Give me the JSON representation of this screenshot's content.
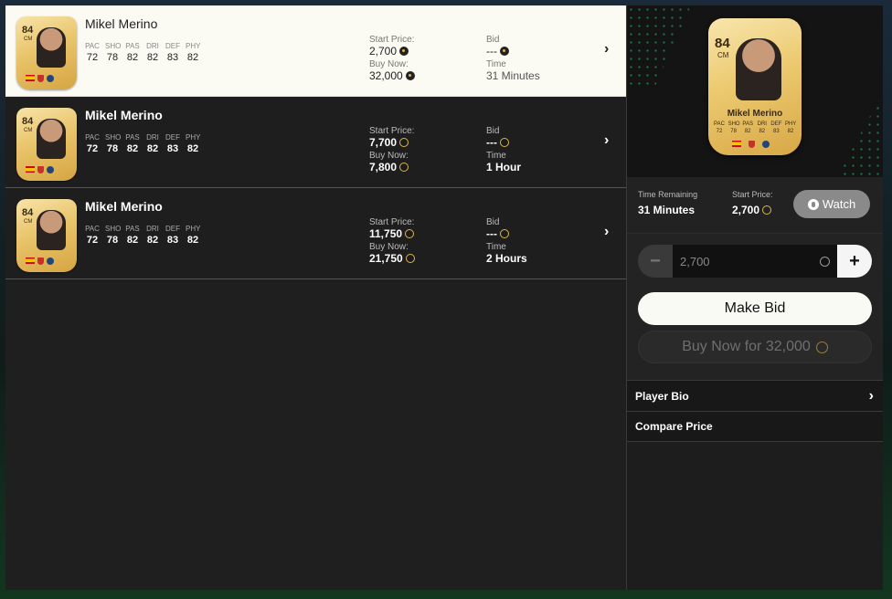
{
  "listings": [
    {
      "name": "Mikel Merino",
      "rating": "84",
      "position": "CM",
      "stats": [
        {
          "label": "PAC",
          "value": "72"
        },
        {
          "label": "SHO",
          "value": "78"
        },
        {
          "label": "PAS",
          "value": "82"
        },
        {
          "label": "DRI",
          "value": "82"
        },
        {
          "label": "DEF",
          "value": "83"
        },
        {
          "label": "PHY",
          "value": "82"
        }
      ],
      "start_price_label": "Start Price:",
      "start_price": "2,700",
      "buy_now_label": "Buy Now:",
      "buy_now": "32,000",
      "bid_label": "Bid",
      "bid": "---",
      "time_label": "Time",
      "time": "31 Minutes",
      "selected": true
    },
    {
      "name": "Mikel Merino",
      "rating": "84",
      "position": "CM",
      "stats": [
        {
          "label": "PAC",
          "value": "72"
        },
        {
          "label": "SHO",
          "value": "78"
        },
        {
          "label": "PAS",
          "value": "82"
        },
        {
          "label": "DRI",
          "value": "82"
        },
        {
          "label": "DEF",
          "value": "83"
        },
        {
          "label": "PHY",
          "value": "82"
        }
      ],
      "start_price_label": "Start Price:",
      "start_price": "7,700",
      "buy_now_label": "Buy Now:",
      "buy_now": "7,800",
      "bid_label": "Bid",
      "bid": "---",
      "time_label": "Time",
      "time": "1 Hour",
      "selected": false
    },
    {
      "name": "Mikel Merino",
      "rating": "84",
      "position": "CM",
      "stats": [
        {
          "label": "PAC",
          "value": "72"
        },
        {
          "label": "SHO",
          "value": "78"
        },
        {
          "label": "PAS",
          "value": "82"
        },
        {
          "label": "DRI",
          "value": "82"
        },
        {
          "label": "DEF",
          "value": "83"
        },
        {
          "label": "PHY",
          "value": "82"
        }
      ],
      "start_price_label": "Start Price:",
      "start_price": "11,750",
      "buy_now_label": "Buy Now:",
      "buy_now": "21,750",
      "bid_label": "Bid",
      "bid": "---",
      "time_label": "Time",
      "time": "2 Hours",
      "selected": false
    }
  ],
  "detail": {
    "card": {
      "rating": "84",
      "position": "CM",
      "name": "Mikel Merino",
      "stats": [
        {
          "label": "PAC",
          "value": "72"
        },
        {
          "label": "SHO",
          "value": "78"
        },
        {
          "label": "PAS",
          "value": "82"
        },
        {
          "label": "DRI",
          "value": "82"
        },
        {
          "label": "DEF",
          "value": "83"
        },
        {
          "label": "PHY",
          "value": "82"
        }
      ]
    },
    "time_remaining_label": "Time Remaining",
    "time_remaining": "31 Minutes",
    "start_price_label": "Start Price:",
    "start_price": "2,700",
    "watch_label": "Watch",
    "bid_input_value": "2,700",
    "minus_label": "−",
    "plus_label": "+",
    "make_bid_label": "Make Bid",
    "buy_now_label": "Buy Now for 32,000",
    "menu": [
      {
        "label": "Player Bio",
        "has_chevron": true
      },
      {
        "label": "Compare Price",
        "has_chevron": false
      }
    ]
  },
  "colors": {
    "accent_gold": "#e0b64a",
    "selected_row_bg": "#fbfaf3",
    "row_bg": "#1e1e1e",
    "dot_green": "#1fd17a"
  }
}
